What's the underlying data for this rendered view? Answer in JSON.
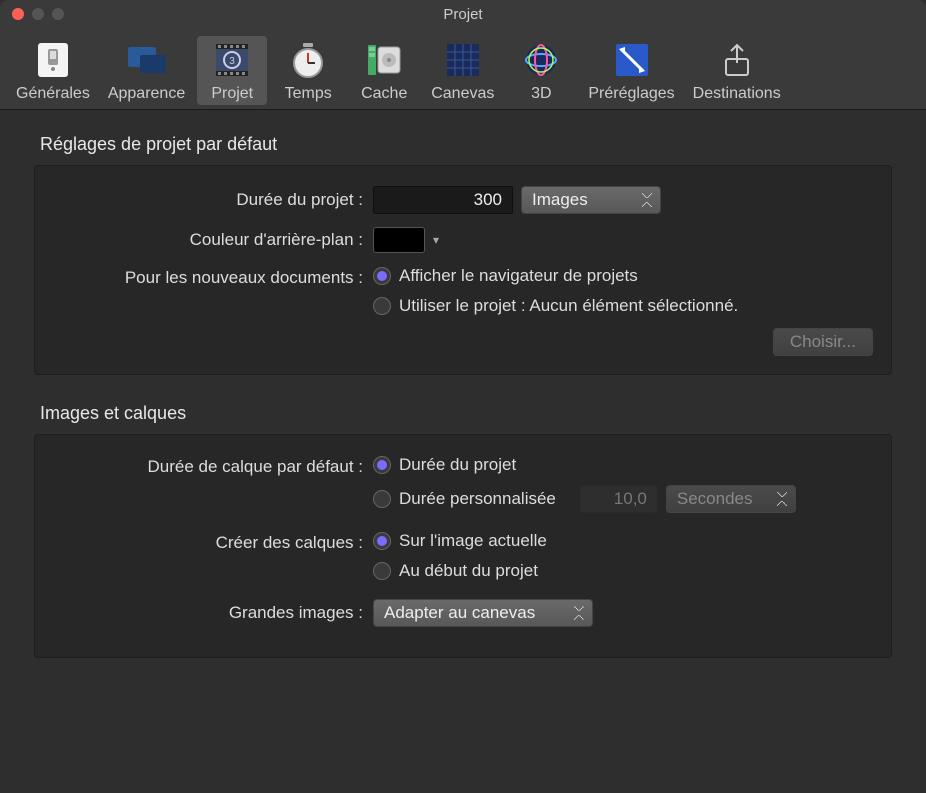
{
  "window": {
    "title": "Projet"
  },
  "toolbar": {
    "items": [
      {
        "label": "Générales"
      },
      {
        "label": "Apparence"
      },
      {
        "label": "Projet"
      },
      {
        "label": "Temps"
      },
      {
        "label": "Cache"
      },
      {
        "label": "Canevas"
      },
      {
        "label": "3D"
      },
      {
        "label": "Préréglages"
      },
      {
        "label": "Destinations"
      }
    ],
    "active_index": 2
  },
  "section1": {
    "title": "Réglages de projet par défaut",
    "duration_label": "Durée du projet :",
    "duration_value": "300",
    "duration_unit": "Images",
    "bgcolor_label": "Couleur d'arrière-plan :",
    "bgcolor_value": "#000000",
    "newdocs_label": "Pour les nouveaux documents :",
    "radio_show": "Afficher le navigateur de projets",
    "radio_use_prefix": "Utiliser le projet : ",
    "radio_use_suffix": "Aucun élément sélectionné.",
    "choose_btn": "Choisir..."
  },
  "section2": {
    "title": "Images et calques",
    "layer_duration_label": "Durée de calque par défaut :",
    "layer_radio_project": "Durée du projet",
    "layer_radio_custom": "Durée personnalisée",
    "layer_custom_value": "10,0",
    "layer_custom_unit": "Secondes",
    "create_label": "Créer des calques :",
    "create_radio_current": "Sur l'image actuelle",
    "create_radio_start": "Au début du projet",
    "large_images_label": "Grandes images :",
    "large_images_value": "Adapter au canevas"
  }
}
